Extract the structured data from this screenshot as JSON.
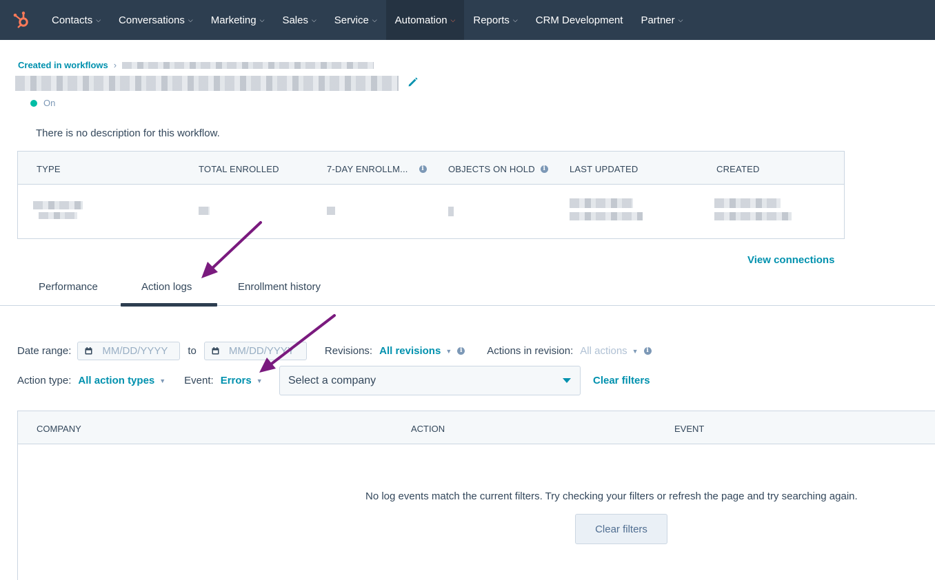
{
  "nav": {
    "items": [
      {
        "label": "Contacts",
        "dropdown": true
      },
      {
        "label": "Conversations",
        "dropdown": true
      },
      {
        "label": "Marketing",
        "dropdown": true
      },
      {
        "label": "Sales",
        "dropdown": true
      },
      {
        "label": "Service",
        "dropdown": true
      },
      {
        "label": "Automation",
        "dropdown": true,
        "active": true
      },
      {
        "label": "Reports",
        "dropdown": true
      },
      {
        "label": "CRM Development",
        "dropdown": false
      },
      {
        "label": "Partner",
        "dropdown": true
      }
    ]
  },
  "header": {
    "breadcrumb": "Created in workflows",
    "status": "On",
    "description": "There is no description for this workflow."
  },
  "stats": {
    "columns": [
      "TYPE",
      "TOTAL ENROLLED",
      "7-DAY ENROLLM...",
      "OBJECTS ON HOLD",
      "LAST UPDATED",
      "CREATED"
    ]
  },
  "view_connections": "View connections",
  "tabs": [
    {
      "label": "Performance"
    },
    {
      "label": "Action logs",
      "selected": true
    },
    {
      "label": "Enrollment history"
    }
  ],
  "filters": {
    "date_range_label": "Date range:",
    "date_placeholder": "MM/DD/YYYY",
    "to_label": "to",
    "revisions_label": "Revisions:",
    "revisions_value": "All revisions",
    "actions_in_revision_label": "Actions in revision:",
    "actions_in_revision_value": "All actions",
    "action_type_label": "Action type:",
    "action_type_value": "All action types",
    "event_label": "Event:",
    "event_value": "Errors",
    "company_placeholder": "Select a company",
    "clear_filters": "Clear filters"
  },
  "logs": {
    "columns": [
      "COMPANY",
      "ACTION",
      "EVENT"
    ],
    "empty_message": "No log events match the current filters. Try checking your filters or refresh the page and try searching again.",
    "clear_button": "Clear filters"
  },
  "colors": {
    "nav_bg": "#2d3e50",
    "accent": "#0091ae",
    "status_on": "#00bda5",
    "annotation_arrow": "#7a1a7e"
  }
}
